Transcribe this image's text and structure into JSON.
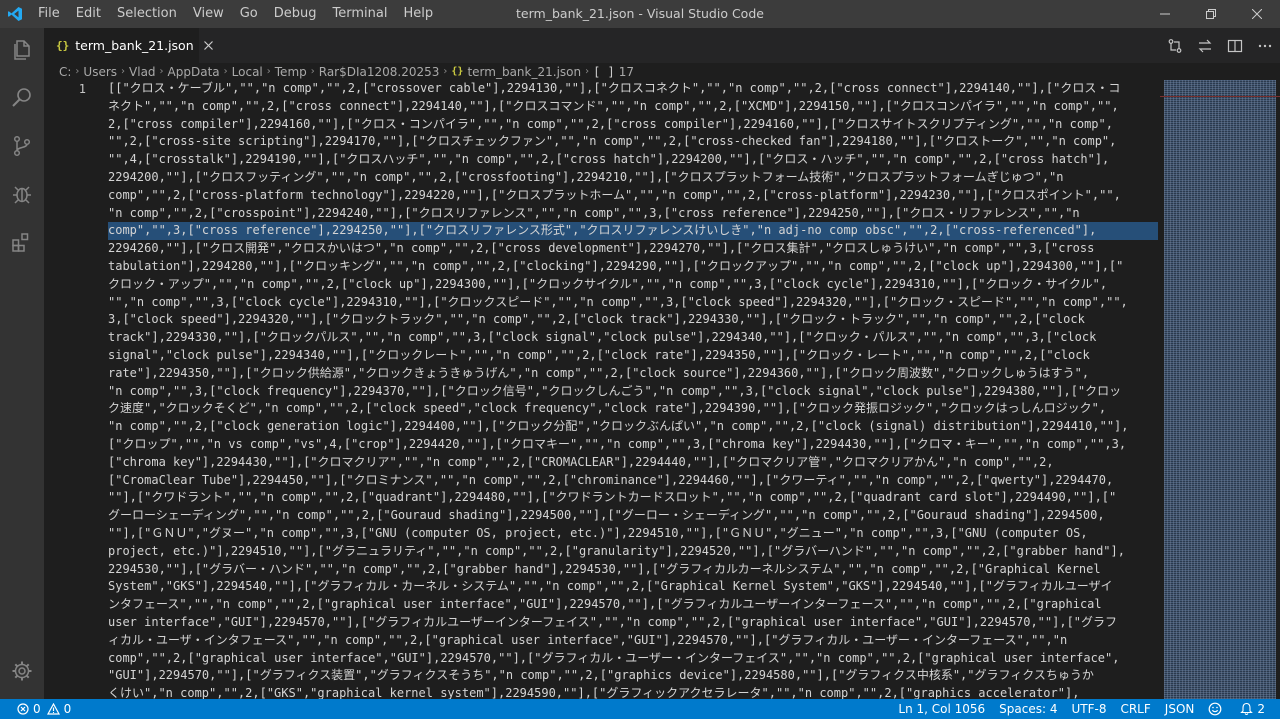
{
  "titlebar": {
    "menu": [
      "File",
      "Edit",
      "Selection",
      "View",
      "Go",
      "Debug",
      "Terminal",
      "Help"
    ],
    "title": "term_bank_21.json - Visual Studio Code"
  },
  "tab": {
    "label": "term_bank_21.json",
    "glyph": "{}"
  },
  "breadcrumbs": {
    "items": [
      "C:",
      "Users",
      "Vlad",
      "AppData",
      "Local",
      "Temp",
      "Rar$DIa1208.20253"
    ],
    "file": "term_bank_21.json",
    "glyph": "{}",
    "array_glyph": "[ ]",
    "array_label": "17"
  },
  "editor": {
    "line_number": "1",
    "lines": [
      "[[\"クロス・ケーブル\",\"\",\"n comp\",\"\",2,[\"crossover cable\"],2294130,\"\"],[\"クロスコネクト\",\"\",\"n comp\",\"\",2,[\"cross connect\"],2294140,\"\"],[\"クロス・コ",
      "ネクト\",\"\",\"n comp\",\"\",2,[\"cross connect\"],2294140,\"\"],[\"クロスコマンド\",\"\",\"n comp\",\"\",2,[\"XCMD\"],2294150,\"\"],[\"クロスコンパイラ\",\"\",\"n comp\",\"\",",
      "2,[\"cross compiler\"],2294160,\"\"],[\"クロス・コンパイラ\",\"\",\"n comp\",\"\",2,[\"cross compiler\"],2294160,\"\"],[\"クロスサイトスクリプティング\",\"\",\"n comp\",",
      "\"\",2,[\"cross-site scripting\"],2294170,\"\"],[\"クロスチェックファン\",\"\",\"n comp\",\"\",2,[\"cross-checked fan\"],2294180,\"\"],[\"クロストーク\",\"\",\"n comp\",",
      "\"\",4,[\"crosstalk\"],2294190,\"\"],[\"クロスハッチ\",\"\",\"n comp\",\"\",2,[\"cross hatch\"],2294200,\"\"],[\"クロス・ハッチ\",\"\",\"n comp\",\"\",2,[\"cross hatch\"],",
      "2294200,\"\"],[\"クロスフッティング\",\"\",\"n comp\",\"\",2,[\"crossfooting\"],2294210,\"\"],[\"クロスプラットフォーム技術\",\"クロスプラットフォームぎじゅつ\",\"n",
      "comp\",\"\",2,[\"cross-platform technology\"],2294220,\"\"],[\"クロスプラットホーム\",\"\",\"n comp\",\"\",2,[\"cross-platform\"],2294230,\"\"],[\"クロスポイント\",\"\",",
      "\"n comp\",\"\",2,[\"crosspoint\"],2294240,\"\"],[\"クロスリファレンス\",\"\",\"n comp\",\"\",3,[\"cross reference\"],2294250,\"\"],[\"クロス・リファレンス\",\"\",\"n",
      "comp\",\"\",3,[\"cross reference\"],2294250,\"\"],[\"クロスリファレンス形式\",\"クロスリファレンスけいしき\",\"n adj-no comp obsc\",\"\",2,[\"cross-referenced\"],",
      "2294260,\"\"],[\"クロス開発\",\"クロスかいはつ\",\"n comp\",\"\",2,[\"cross development\"],2294270,\"\"],[\"クロス集計\",\"クロスしゅうけい\",\"n comp\",\"\",3,[\"cross",
      "tabulation\"],2294280,\"\"],[\"クロッキング\",\"\",\"n comp\",\"\",2,[\"clocking\"],2294290,\"\"],[\"クロックアップ\",\"\",\"n comp\",\"\",2,[\"clock up\"],2294300,\"\"],[\"",
      "クロック・アップ\",\"\",\"n comp\",\"\",2,[\"clock up\"],2294300,\"\"],[\"クロックサイクル\",\"\",\"n comp\",\"\",3,[\"clock cycle\"],2294310,\"\"],[\"クロック・サイクル\",",
      "\"\",\"n comp\",\"\",3,[\"clock cycle\"],2294310,\"\"],[\"クロックスピード\",\"\",\"n comp\",\"\",3,[\"clock speed\"],2294320,\"\"],[\"クロック・スピード\",\"\",\"n comp\",\"\",",
      "3,[\"clock speed\"],2294320,\"\"],[\"クロックトラック\",\"\",\"n comp\",\"\",2,[\"clock track\"],2294330,\"\"],[\"クロック・トラック\",\"\",\"n comp\",\"\",2,[\"clock",
      "track\"],2294330,\"\"],[\"クロックパルス\",\"\",\"n comp\",\"\",3,[\"clock signal\",\"clock pulse\"],2294340,\"\"],[\"クロック・パルス\",\"\",\"n comp\",\"\",3,[\"clock",
      "signal\",\"clock pulse\"],2294340,\"\"],[\"クロックレート\",\"\",\"n comp\",\"\",2,[\"clock rate\"],2294350,\"\"],[\"クロック・レート\",\"\",\"n comp\",\"\",2,[\"clock",
      "rate\"],2294350,\"\"],[\"クロック供給源\",\"クロックきょうきゅうげん\",\"n comp\",\"\",2,[\"clock source\"],2294360,\"\"],[\"クロック周波数\",\"クロックしゅうはすう\",",
      "\"n comp\",\"\",3,[\"clock frequency\"],2294370,\"\"],[\"クロック信号\",\"クロックしんごう\",\"n comp\",\"\",3,[\"clock signal\",\"clock pulse\"],2294380,\"\"],[\"クロッ",
      "ク速度\",\"クロックそくど\",\"n comp\",\"\",2,[\"clock speed\",\"clock frequency\",\"clock rate\"],2294390,\"\"],[\"クロック発振ロジック\",\"クロックはっしんロジック\",",
      "\"n comp\",\"\",2,[\"clock generation logic\"],2294400,\"\"],[\"クロック分配\",\"クロックぶんぱい\",\"n comp\",\"\",2,[\"clock (signal) distribution\"],2294410,\"\"],",
      "[\"クロップ\",\"\",\"n vs comp\",\"vs\",4,[\"crop\"],2294420,\"\"],[\"クロマキー\",\"\",\"n comp\",\"\",3,[\"chroma key\"],2294430,\"\"],[\"クロマ・キー\",\"\",\"n comp\",\"\",3,",
      "[\"chroma key\"],2294430,\"\"],[\"クロマクリア\",\"\",\"n comp\",\"\",2,[\"CROMACLEAR\"],2294440,\"\"],[\"クロマクリア管\",\"クロマクリアかん\",\"n comp\",\"\",2,",
      "[\"CromaClear Tube\"],2294450,\"\"],[\"クロミナンス\",\"\",\"n comp\",\"\",2,[\"chrominance\"],2294460,\"\"],[\"クワーティ\",\"\",\"n comp\",\"\",2,[\"qwerty\"],2294470,",
      "\"\"],[\"クワドラント\",\"\",\"n comp\",\"\",2,[\"quadrant\"],2294480,\"\"],[\"クワドラントカードスロット\",\"\",\"n comp\",\"\",2,[\"quadrant card slot\"],2294490,\"\"],[\"",
      "グーローシェーディング\",\"\",\"n comp\",\"\",2,[\"Gouraud shading\"],2294500,\"\"],[\"グーロー・シェーディング\",\"\",\"n comp\",\"\",2,[\"Gouraud shading\"],2294500,",
      "\"\"],[\"ＧＮＵ\",\"グヌー\",\"n comp\",\"\",3,[\"GNU (computer OS, project, etc.)\"],2294510,\"\"],[\"ＧＮＵ\",\"グニュー\",\"n comp\",\"\",3,[\"GNU (computer OS,",
      "project, etc.)\"],2294510,\"\"],[\"グラニュラリティ\",\"\",\"n comp\",\"\",2,[\"granularity\"],2294520,\"\"],[\"グラバーハンド\",\"\",\"n comp\",\"\",2,[\"grabber hand\"],",
      "2294530,\"\"],[\"グラバー・ハンド\",\"\",\"n comp\",\"\",2,[\"grabber hand\"],2294530,\"\"],[\"グラフィカルカーネルシステム\",\"\",\"n comp\",\"\",2,[\"Graphical Kernel",
      "System\",\"GKS\"],2294540,\"\"],[\"グラフィカル・カーネル・システム\",\"\",\"n comp\",\"\",2,[\"Graphical Kernel System\",\"GKS\"],2294540,\"\"],[\"グラフィカルユーザイ",
      "ンタフェース\",\"\",\"n comp\",\"\",2,[\"graphical user interface\",\"GUI\"],2294570,\"\"],[\"グラフィカルユーザーインターフェース\",\"\",\"n comp\",\"\",2,[\"graphical",
      "user interface\",\"GUI\"],2294570,\"\"],[\"グラフィカルユーザーインターフェイス\",\"\",\"n comp\",\"\",2,[\"graphical user interface\",\"GUI\"],2294570,\"\"],[\"グラフ",
      "ィカル・ユーザ・インタフェース\",\"\",\"n comp\",\"\",2,[\"graphical user interface\",\"GUI\"],2294570,\"\"],[\"グラフィカル・ユーザー・インターフェース\",\"\",\"n",
      "comp\",\"\",2,[\"graphical user interface\",\"GUI\"],2294570,\"\"],[\"グラフィカル・ユーザー・インターフェイス\",\"\",\"n comp\",\"\",2,[\"graphical user interface\",",
      "\"GUI\"],2294570,\"\"],[\"グラフィクス装置\",\"グラフィクスそうち\",\"n comp\",\"\",2,[\"graphics device\"],2294580,\"\"],[\"グラフィクス中核系\",\"グラフィクスちゅうか",
      "くけい\",\"n comp\",\"\",2,[\"GKS\",\"graphical kernel system\"],2294590,\"\"],[\"グラフィックアクセラレータ\",\"\",\"n comp\",\"\",2,[\"graphics accelerator\"],"
    ]
  },
  "statusbar": {
    "errors": "0",
    "warnings": "0",
    "position": "Ln 1, Col 1056",
    "spaces": "Spaces: 4",
    "encoding": "UTF-8",
    "eol": "CRLF",
    "language": "JSON",
    "notifications": "2"
  }
}
